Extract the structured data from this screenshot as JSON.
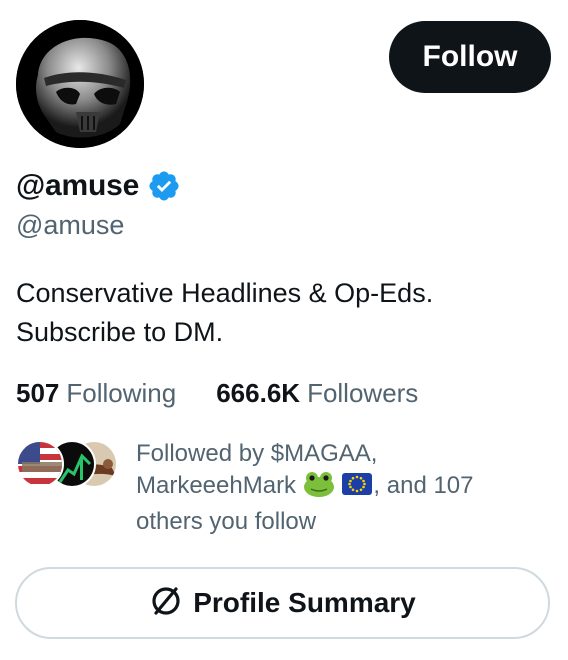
{
  "profile": {
    "display_name": "@amuse",
    "handle": "@amuse",
    "verified": true,
    "verified_color": "#1d9bf0",
    "bio_lines": [
      "Conservative Headlines & Op-Eds.",
      "Subscribe to DM."
    ]
  },
  "actions": {
    "follow_label": "Follow",
    "summary_label": "Profile Summary",
    "summary_icon": "no-entry-slash-icon"
  },
  "stats": {
    "following_count": "507",
    "following_label": "Following",
    "followers_count": "666.6K",
    "followers_label": "Followers"
  },
  "followed_by": {
    "prefix": "Followed by $MAGAA,",
    "second_name": "MarkeeehMark",
    "second_emojis": [
      "frog-emoji",
      "eu-flag-emoji"
    ],
    "suffix": ", and 107",
    "tail": "others you follow"
  },
  "colors": {
    "text_primary": "#0f1419",
    "text_secondary": "#536471",
    "border": "#cfd9de"
  }
}
